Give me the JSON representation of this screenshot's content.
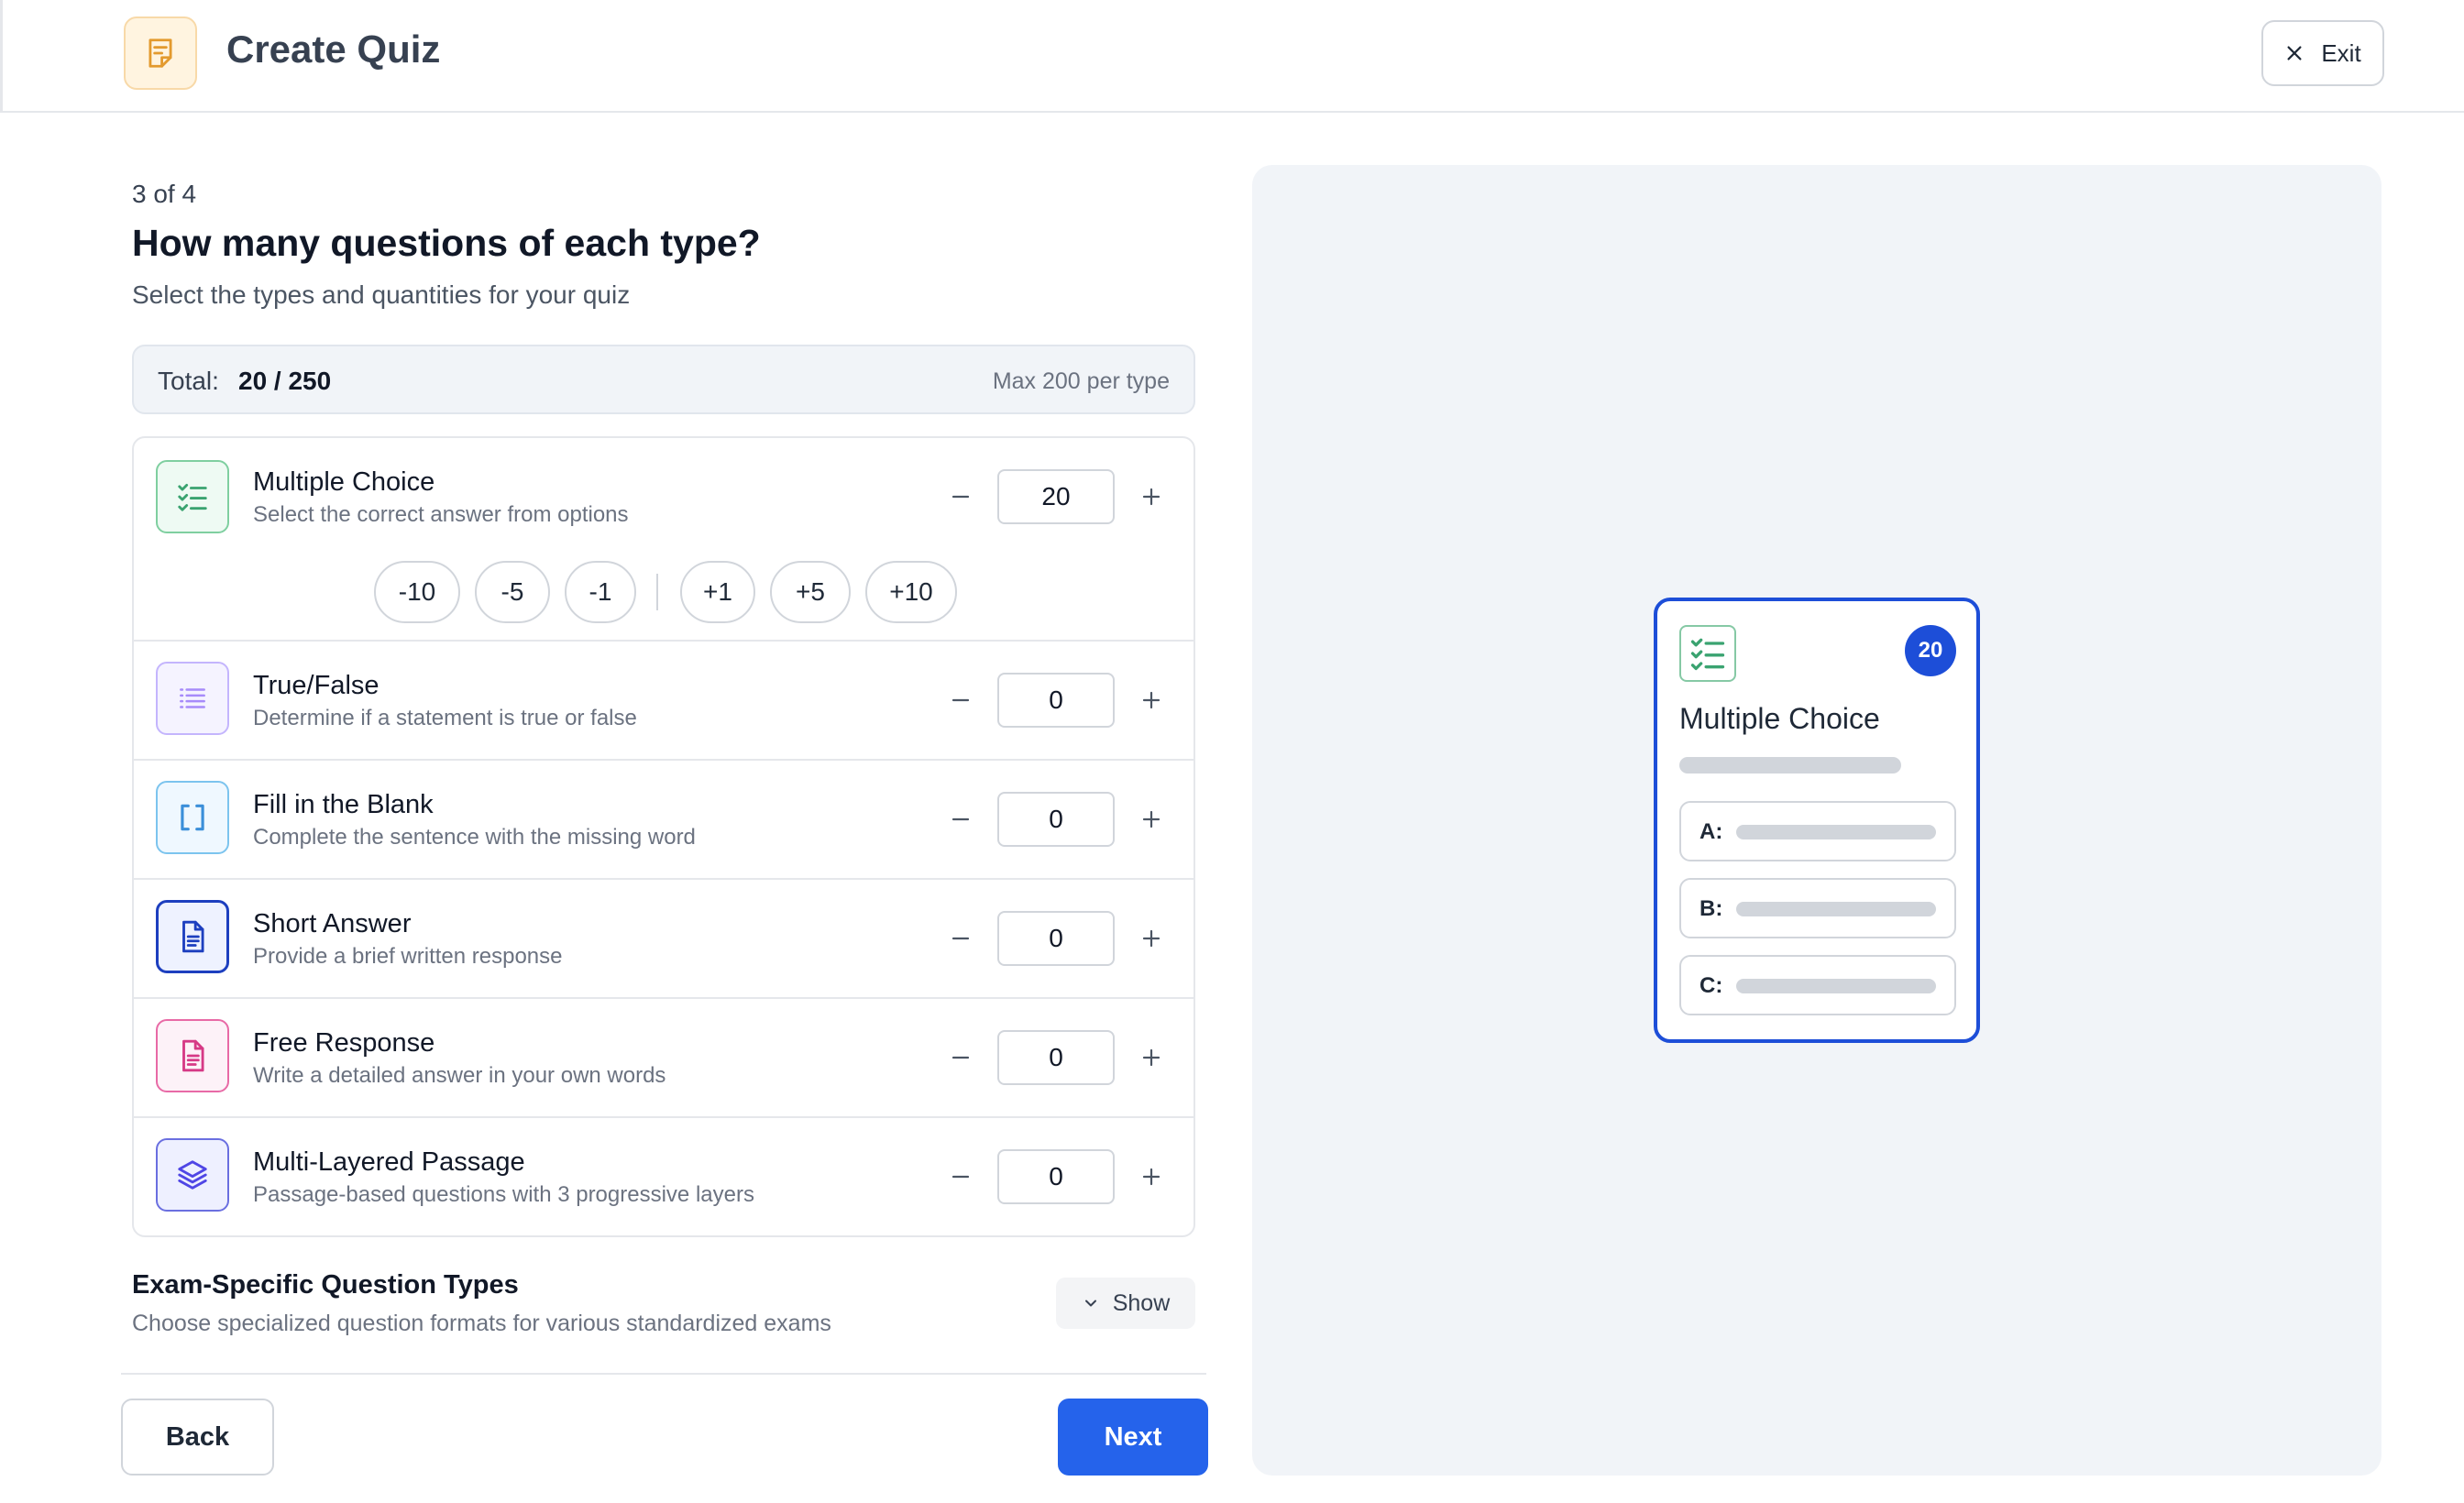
{
  "header": {
    "title": "Create Quiz",
    "exit_label": "Exit"
  },
  "step": {
    "label": "3 of 4",
    "title": "How many questions of each type?",
    "subtitle": "Select the types and quantities for your quiz"
  },
  "totals": {
    "label": "Total:",
    "value": "20 / 250",
    "max_note": "Max 200 per type"
  },
  "question_types": [
    {
      "name": "Multiple Choice",
      "description": "Select the correct answer from options",
      "count": "20",
      "icon": "checklist-icon"
    },
    {
      "name": "True/False",
      "description": "Determine if a statement is true or false",
      "count": "0",
      "icon": "list-icon"
    },
    {
      "name": "Fill in the Blank",
      "description": "Complete the sentence with the missing word",
      "count": "0",
      "icon": "brackets-icon"
    },
    {
      "name": "Short Answer",
      "description": "Provide a brief written response",
      "count": "0",
      "icon": "document-icon"
    },
    {
      "name": "Free Response",
      "description": "Write a detailed answer in your own words",
      "count": "0",
      "icon": "document-icon"
    },
    {
      "name": "Multi-Layered Passage",
      "description": "Passage-based questions with 3 progressive layers",
      "count": "0",
      "icon": "layers-icon"
    }
  ],
  "quick_adjust": [
    "-10",
    "-5",
    "-1",
    "+1",
    "+5",
    "+10"
  ],
  "exam": {
    "title": "Exam-Specific Question Types",
    "description": "Choose specialized question formats for various standardized exams",
    "toggle_label": "Show"
  },
  "nav": {
    "back_label": "Back",
    "next_label": "Next"
  },
  "preview": {
    "type_name": "Multiple Choice",
    "count": "20",
    "options": [
      "A:",
      "B:",
      "C:"
    ]
  },
  "colors": {
    "accent": "#2563eb",
    "preview_border": "#1d4ed8",
    "panel_bg": "#f1f4f8"
  }
}
